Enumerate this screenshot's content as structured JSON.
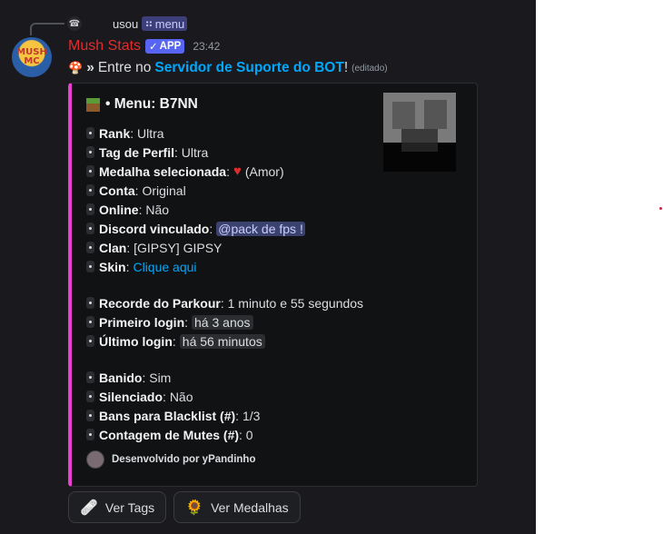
{
  "reply": {
    "user": "usou",
    "command": "menu",
    "command_icon": "grid-icon"
  },
  "author": {
    "avatar_text": "MUSH MC",
    "name": "Mush Stats",
    "badge": "APP",
    "time": "23:42"
  },
  "message": {
    "arrows": "»",
    "prefix": "Entre no",
    "link": "Servidor de Suporte do BOT",
    "suffix": "!",
    "edited": "(editado)"
  },
  "embed": {
    "accent": "#e93fce",
    "title": "• Menu: B7NN",
    "group1": [
      {
        "key": "Rank",
        "value": "Ultra"
      },
      {
        "key": "Tag de Perfil",
        "value": "Ultra"
      },
      {
        "key": "Medalha selecionada",
        "value": "(Amor)"
      },
      {
        "key": "Conta",
        "value": "Original"
      },
      {
        "key": "Online",
        "value": "Não"
      },
      {
        "key": "Discord vinculado",
        "value": "@pack de fps !"
      },
      {
        "key": "Clan",
        "value": "[GIPSY] GIPSY"
      },
      {
        "key": "Skin",
        "value": "Clique aqui"
      }
    ],
    "group2": [
      {
        "key": "Recorde do Parkour",
        "value": "1 minuto e 55 segundos"
      },
      {
        "key": "Primeiro login",
        "value": "há 3 anos"
      },
      {
        "key": "Último login",
        "value": "há 56 minutos"
      }
    ],
    "group3": [
      {
        "key": "Banido",
        "value": "Sim"
      },
      {
        "key": "Silenciado",
        "value": "Não"
      },
      {
        "key": "Bans para Blacklist (#)",
        "value": "1/3"
      },
      {
        "key": "Contagem de Mutes (#)",
        "value": "0"
      }
    ],
    "footer": "Desenvolvido por yPandinho"
  },
  "buttons": [
    {
      "label": "Ver Tags",
      "icon": "bandage-icon"
    },
    {
      "label": "Ver Medalhas",
      "icon": "sunflower-icon"
    }
  ]
}
